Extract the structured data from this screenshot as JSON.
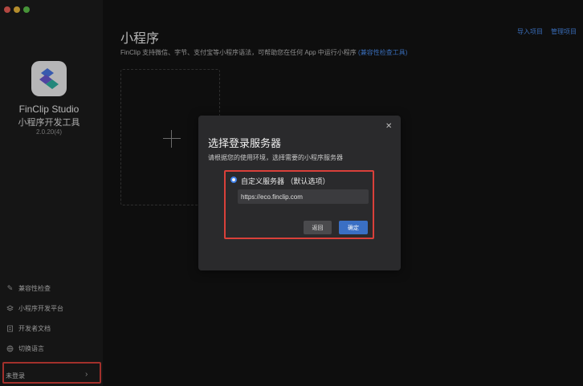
{
  "app": {
    "name": "FinClip Studio",
    "subtitle": "小程序开发工具",
    "version": "2.0.20(4)"
  },
  "sidebar": {
    "items": [
      {
        "label": "兼容性检查",
        "icon": "edit-icon"
      },
      {
        "label": "小程序开发平台",
        "icon": "layers-icon"
      },
      {
        "label": "开发者文档",
        "icon": "document-icon"
      },
      {
        "label": "切换语言",
        "icon": "globe-icon"
      }
    ],
    "login": {
      "label": "未登录"
    }
  },
  "main": {
    "title": "小程序",
    "links": {
      "import": "导入项目",
      "manage": "管理项目"
    },
    "description": "FinClip 支持微信、字节、支付宝等小程序语法，可帮助您在任何 App 中运行小程序",
    "description_link": "(兼容性检查工具)"
  },
  "dialog": {
    "title": "选择登录服务器",
    "description": "请根据您的使用环境，选择需要的小程序服务器",
    "option_label": "自定义服务器 （默认选项）",
    "url_value": "https://eco.finclip.com",
    "back_label": "返回",
    "confirm_label": "确定"
  },
  "colors": {
    "accent": "#3a6fc4",
    "link": "#4b8ff2",
    "highlight": "#d9403a"
  }
}
